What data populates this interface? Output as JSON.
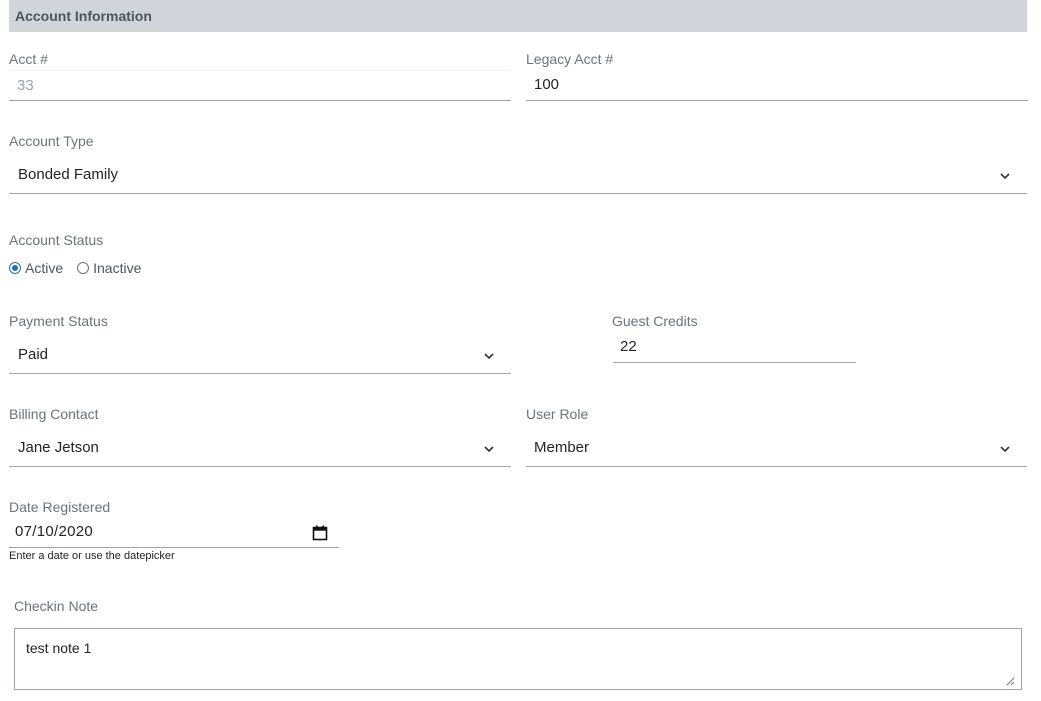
{
  "section": {
    "title": "Account Information"
  },
  "fields": {
    "acct_num": {
      "label": "Acct #",
      "value": "33"
    },
    "legacy_acct": {
      "label": "Legacy Acct #",
      "value": "100"
    },
    "account_type": {
      "label": "Account Type",
      "value": "Bonded Family"
    },
    "account_status": {
      "label": "Account Status",
      "options": [
        {
          "label": "Active",
          "checked": true
        },
        {
          "label": "Inactive",
          "checked": false
        }
      ]
    },
    "payment_status": {
      "label": "Payment Status",
      "value": "Paid"
    },
    "guest_credits": {
      "label": "Guest Credits",
      "value": "22"
    },
    "billing_contact": {
      "label": "Billing Contact",
      "value": "Jane Jetson"
    },
    "user_role": {
      "label": "User Role",
      "value": "Member"
    },
    "date_registered": {
      "label": "Date Registered",
      "value": "07/10/2020",
      "hint": "Enter a date or use the datepicker"
    },
    "checkin_note": {
      "label": "Checkin Note",
      "value": "test note 1"
    }
  },
  "icons": {
    "chevron": "chevron-down-icon",
    "calendar": "calendar-icon",
    "radio_selected_color": "#1d72b8"
  }
}
